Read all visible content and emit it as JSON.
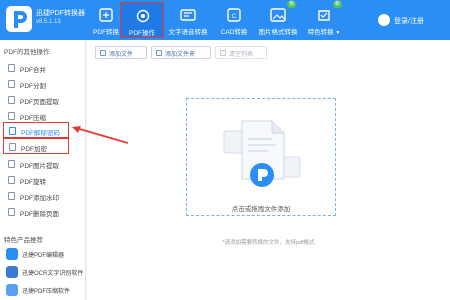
{
  "app": {
    "title": "迅捷PDF转换器",
    "version": "v8.5.1.13"
  },
  "toolbar": [
    {
      "label": "PDF转换",
      "icon": "pdf-convert-icon"
    },
    {
      "label": "PDF操作",
      "icon": "pdf-operate-icon",
      "active": true
    },
    {
      "label": "文字语音转换",
      "icon": "text-speech-icon"
    },
    {
      "label": "CAD转换",
      "icon": "cad-icon"
    },
    {
      "label": "图片格式转换",
      "icon": "image-format-icon",
      "badge": "热"
    },
    {
      "label": "特色转换",
      "icon": "special-convert-icon",
      "badge": "新"
    }
  ],
  "login_label": "登录/注册",
  "sidebar": {
    "section_title": "PDF的其他操作",
    "items": [
      {
        "label": "PDF合并"
      },
      {
        "label": "PDF分割"
      },
      {
        "label": "PDF页面提取"
      },
      {
        "label": "PDF压缩"
      },
      {
        "label": "PDF解除密码"
      },
      {
        "label": "PDF加密"
      },
      {
        "label": "PDF图片提取"
      },
      {
        "label": "PDF旋转"
      },
      {
        "label": "PDF添加水印"
      },
      {
        "label": "PDF删除页面"
      }
    ],
    "products_title": "特色产品推荐",
    "products": [
      {
        "label": "迅捷PDF编辑器"
      },
      {
        "label": "迅捷OCR文字识别软件"
      },
      {
        "label": "迅捷PDF压缩软件"
      }
    ]
  },
  "actions": {
    "add_file": "添加文件",
    "add_folder": "添加文件夹",
    "clear_list": "清空列表"
  },
  "dropzone": {
    "label": "点击或拖拽文件添加",
    "hint": "*请添加需要转换的文件，支持pdf格式"
  },
  "colors": {
    "brand": "#2b8ef5",
    "highlight": "#e53935"
  }
}
